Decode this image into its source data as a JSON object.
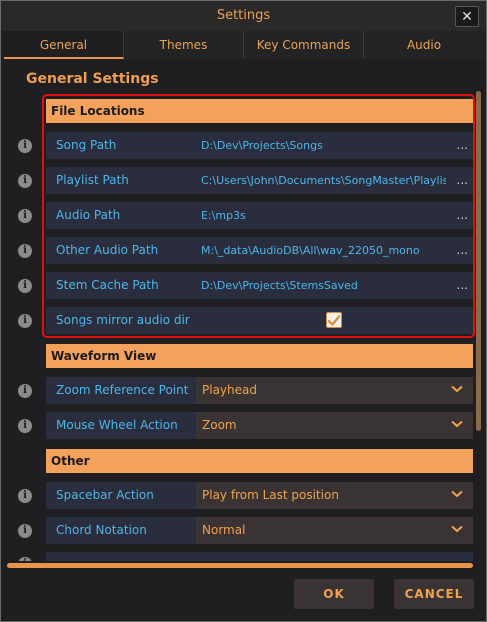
{
  "window": {
    "title": "Settings",
    "close_glyph": "✕"
  },
  "tabs": [
    {
      "label": "General",
      "active": true
    },
    {
      "label": "Themes",
      "active": false
    },
    {
      "label": "Key Commands",
      "active": false
    },
    {
      "label": "Audio",
      "active": false
    }
  ],
  "section_title": "General Settings",
  "file_locations": {
    "header": "File Locations",
    "rows": [
      {
        "label": "Song Path",
        "value": "D:\\Dev\\Projects\\Songs"
      },
      {
        "label": "Playlist Path",
        "value": "C:\\Users\\John\\Documents\\SongMaster\\Playlist"
      },
      {
        "label": "Audio Path",
        "value": "E:\\mp3s"
      },
      {
        "label": "Other Audio Path",
        "value": "M:\\_data\\AudioDB\\All\\wav_22050_mono"
      },
      {
        "label": "Stem Cache Path",
        "value": "D:\\Dev\\Projects\\StemsSaved"
      }
    ],
    "browse_glyph": "...",
    "mirror": {
      "label": "Songs mirror audio dir",
      "checked": true
    }
  },
  "waveform_view": {
    "header": "Waveform View",
    "rows": [
      {
        "label": "Zoom Reference Point",
        "value": "Playhead"
      },
      {
        "label": "Mouse Wheel Action",
        "value": "Zoom"
      }
    ]
  },
  "other": {
    "header": "Other",
    "rows": [
      {
        "label": "Spacebar Action",
        "value": "Play from Last position"
      },
      {
        "label": "Chord Notation",
        "value": "Normal"
      }
    ]
  },
  "info_glyph": "i",
  "buttons": {
    "ok": "OK",
    "cancel": "CANCEL"
  },
  "colors": {
    "accent": "#f0a24e",
    "label_blue": "#4db6e8",
    "highlight_red": "#e01010",
    "group_header": "#f4a15b"
  }
}
